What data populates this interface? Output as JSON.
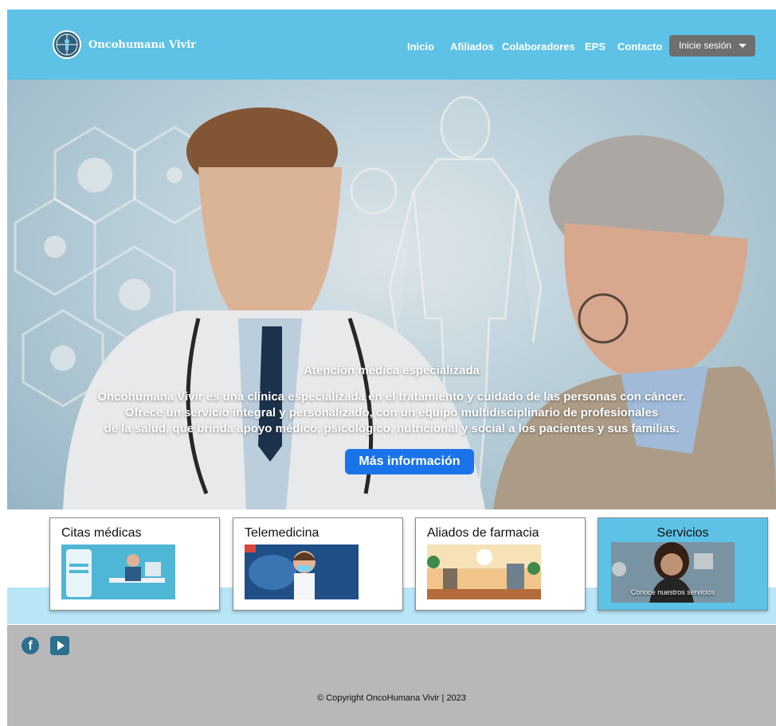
{
  "brand": {
    "name": "Oncohumana Vivir",
    "logo_icon": "logo-circle-icon"
  },
  "nav": {
    "links": [
      "Inicio",
      "Afiliados",
      "Colaboradores",
      "EPS",
      "Contacto"
    ],
    "login_label": "Inicie sesión"
  },
  "hero": {
    "title": "Atención médica especializada",
    "line1": "Oncohumana Vivir es una clínica especializada en el tratamiento y cuidado de las personas con cáncer.",
    "line2": "Ofrece un servicio integral y personalizado, con un equipo multidisciplinario de profesionales",
    "line3": "de la salud, que brinda apoyo médico, psicológico, nutricional y social a los pacientes y sus familias.",
    "button_label": "Más información"
  },
  "cards": [
    {
      "title": "Citas médicas"
    },
    {
      "title": "Telemedicina"
    },
    {
      "title": "Aliados de farmacia"
    },
    {
      "title": "Servicios",
      "caption": "Conoce nuestros servicios"
    }
  ],
  "footer": {
    "social_icons": [
      "facebook-icon",
      "youtube-icon"
    ],
    "copyright": "© Copyright OncoHumana Vivir | 2023"
  },
  "colors": {
    "navbar": "#5dc2e6",
    "button": "#1a73e8",
    "footer": "#b8b8b8",
    "login": "#6e6e6e"
  }
}
